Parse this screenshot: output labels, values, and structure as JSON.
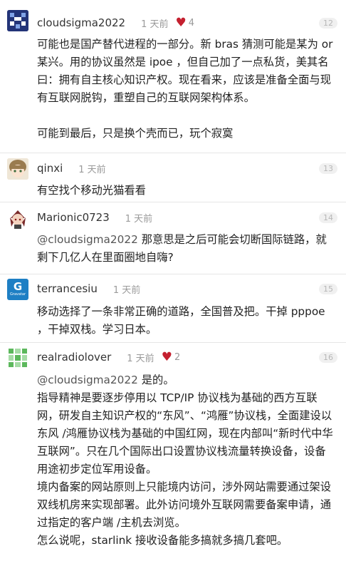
{
  "posts": [
    {
      "username": "cloudsigma2022",
      "time": "1 天前",
      "likes": "4",
      "number": "12",
      "paragraphs": [
        "可能也是国产替代进程的一部分。新 bras 猜测可能是某为 or 某兴。用的协议虽然是 ipoe ，但自己加了一点私货，美其名曰：拥有自主核心知识产权。现在看来，应该是准备全面与现有互联网脱钩，重塑自己的互联网架构体系。",
        "可能到最后，只是换个壳而已，玩个寂寞"
      ]
    },
    {
      "username": "qinxi",
      "time": "1 天前",
      "number": "13",
      "paragraphs": [
        "有空找个移动光猫看看"
      ]
    },
    {
      "username": "Marionic0723",
      "time": "1 天前",
      "number": "14",
      "mention": "@cloudsigma2022",
      "paragraphs": [
        " 那意思是之后可能会切断国际链路，就剩下几亿人在里面圈地自嗨?"
      ]
    },
    {
      "username": "terrancesiu",
      "time": "1 天前",
      "number": "15",
      "avatar_text": "Gravatar",
      "paragraphs": [
        "移动选择了一条非常正确的道路，全国普及把。干掉 pppoe ，干掉双栈。学习日本。"
      ]
    },
    {
      "username": "realradiolover",
      "time": "1 天前",
      "likes": "2",
      "number": "16",
      "mention": "@cloudsigma2022",
      "mention_suffix": " 是的。",
      "paragraphs": [
        "指导精神是要逐步停用以 TCP/IP 协议栈为基础的西方互联网，研发自主知识产权的“东风”、“鸿雁”协议栈，全面建设以东风 /鸿雁协议栈为基础的中国红网，现在内部叫“新时代中华互联网”。只在几个国际出口设置协议栈流量转换设备，设备用途初步定位军用设备。",
        "境内备案的网站原则上只能境内访问，涉外网站需要通过架设双线机房来实现部署。此外访问境外互联网需要备案申请，通过指定的客户端 /主机去浏览。",
        "怎么说呢，starlink 接收设备能多搞就多搞几套吧。"
      ]
    }
  ],
  "colors": {
    "accent_heart": "#c4202f",
    "gravatar_blue": "#1e7fc4"
  }
}
